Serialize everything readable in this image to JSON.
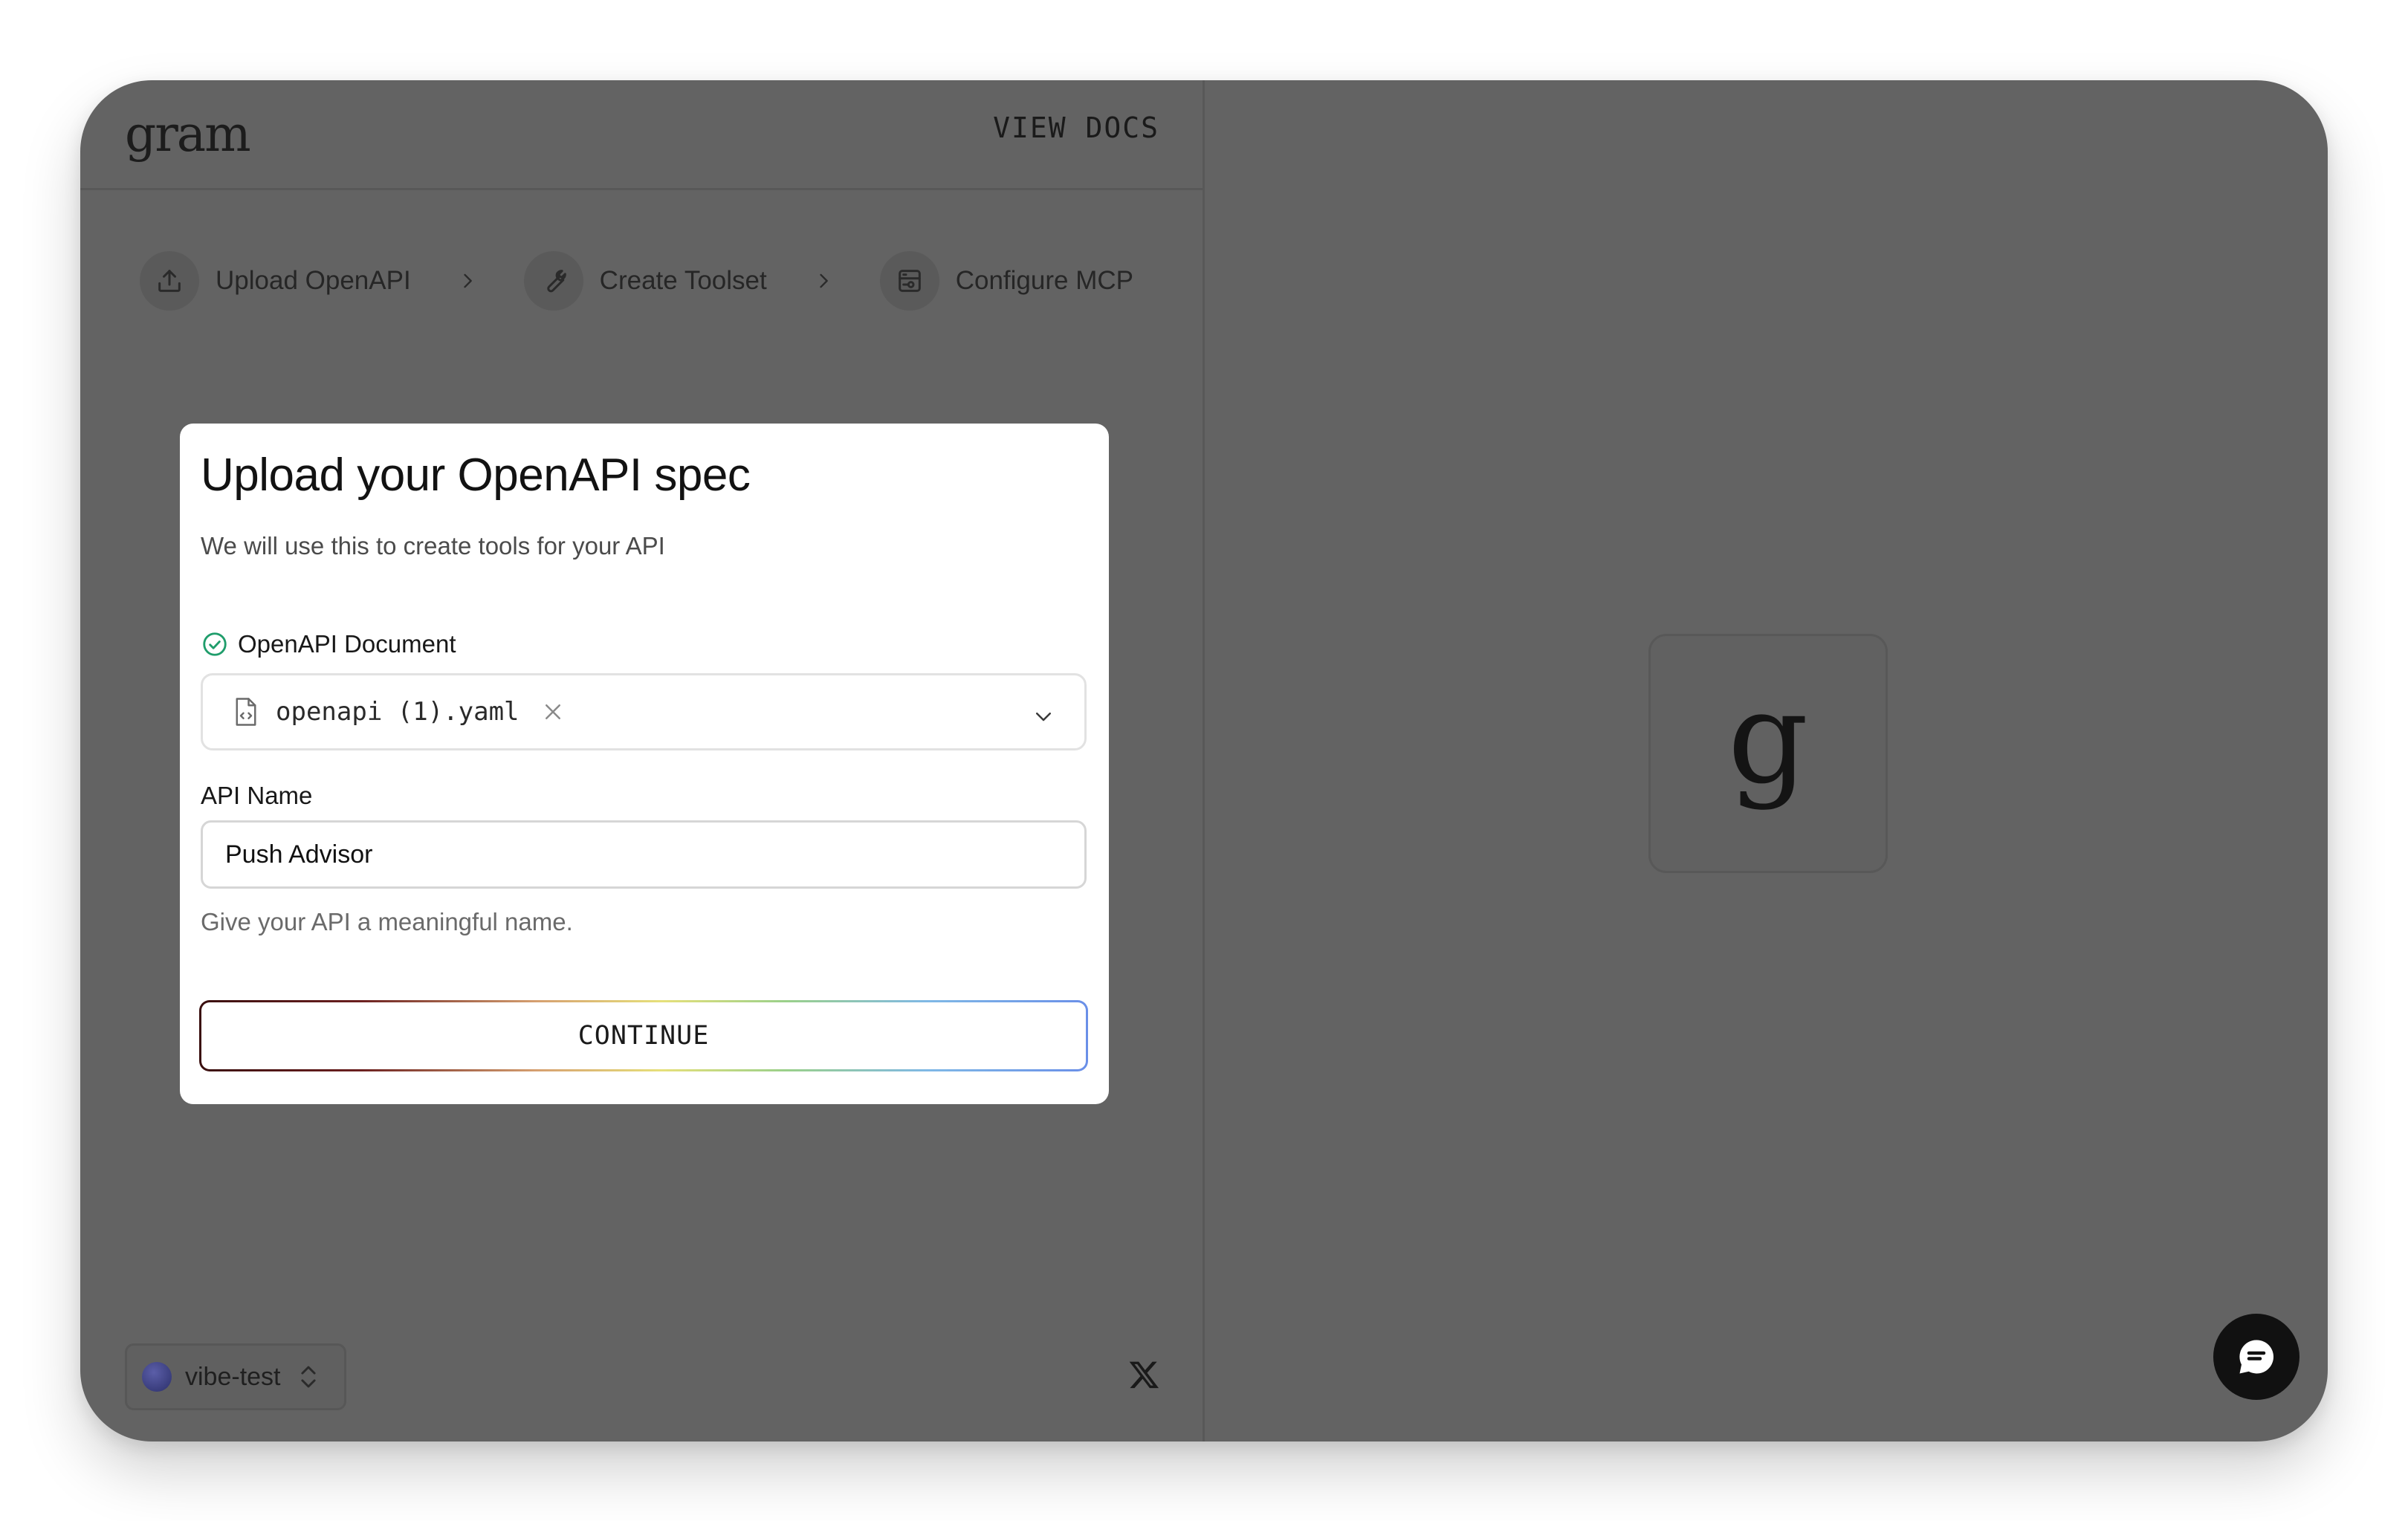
{
  "app": {
    "logo": "gram"
  },
  "header": {
    "view_docs": "VIEW DOCS"
  },
  "steps": [
    {
      "label": "Upload OpenAPI",
      "icon": "upload-icon"
    },
    {
      "label": "Create Toolset",
      "icon": "wrench-icon"
    },
    {
      "label": "Configure MCP",
      "icon": "server-icon"
    }
  ],
  "card": {
    "title": "Upload your OpenAPI spec",
    "subtitle": "We will use this to create tools for your API",
    "doc_label": "OpenAPI Document",
    "file_name": "openapi (1).yaml",
    "api_name_label": "API Name",
    "api_name_value": "Push Advisor",
    "api_name_help": "Give your API a meaningful name.",
    "continue_label": "CONTINUE"
  },
  "workspace": {
    "name": "vibe-test"
  },
  "preview": {
    "letter": "g"
  },
  "colors": {
    "success": "#1f9d6b",
    "background": "#636363",
    "card": "#ffffff"
  }
}
